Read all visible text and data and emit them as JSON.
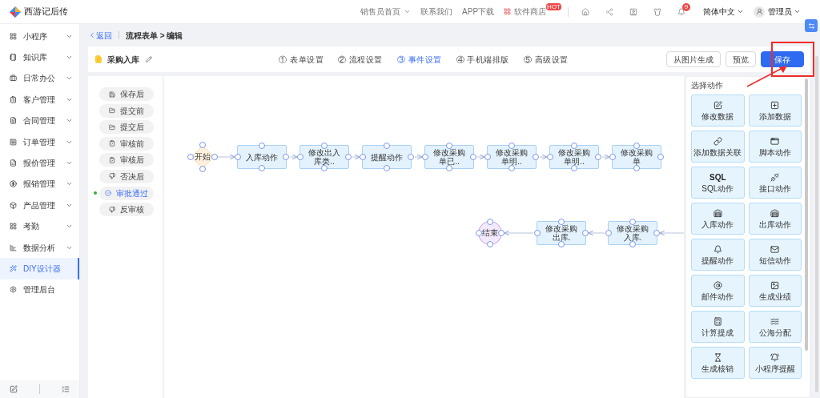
{
  "header": {
    "brand": "西游记后传",
    "links": [
      {
        "label": "销售员首页",
        "caret": true
      },
      {
        "label": "联系我们",
        "caret": false
      },
      {
        "label": "APP下载",
        "caret": false
      }
    ],
    "store": {
      "label": "软件商店",
      "badge": "HOT"
    },
    "notification_badge": "9",
    "language": "简体中文",
    "user": "管理员"
  },
  "sidebar": {
    "items": [
      {
        "label": "小程序",
        "expandable": true,
        "selected": false
      },
      {
        "label": "知识库",
        "expandable": true,
        "selected": false
      },
      {
        "label": "日常办公",
        "expandable": true,
        "selected": false
      },
      {
        "label": "客户管理",
        "expandable": true,
        "selected": false
      },
      {
        "label": "合同管理",
        "expandable": true,
        "selected": false
      },
      {
        "label": "订单管理",
        "expandable": true,
        "selected": false
      },
      {
        "label": "报价管理",
        "expandable": true,
        "selected": false
      },
      {
        "label": "报销管理",
        "expandable": true,
        "selected": false
      },
      {
        "label": "产品管理",
        "expandable": true,
        "selected": false
      },
      {
        "label": "考勤",
        "expandable": true,
        "selected": false
      },
      {
        "label": "数据分析",
        "expandable": true,
        "selected": false
      },
      {
        "label": "DIY设计器",
        "expandable": false,
        "selected": true
      },
      {
        "label": "管理后台",
        "expandable": false,
        "selected": false
      }
    ]
  },
  "breadcrumb": {
    "back": "返回",
    "path": "流程表单 > 编辑"
  },
  "toolbar": {
    "form_name": "采购入库",
    "tabs": [
      {
        "label": "① 表单设置",
        "selected": false
      },
      {
        "label": "② 流程设置",
        "selected": false
      },
      {
        "label": "③ 事件设置",
        "selected": true
      },
      {
        "label": "④ 手机端排版",
        "selected": false
      },
      {
        "label": "⑤ 高级设置",
        "selected": false
      }
    ],
    "buttons": [
      {
        "label": "从图片生成",
        "kind": "default"
      },
      {
        "label": "预览",
        "kind": "default"
      },
      {
        "label": "保存",
        "kind": "primary"
      }
    ]
  },
  "events": [
    {
      "label": "保存后",
      "selected": false
    },
    {
      "label": "提交前",
      "selected": false
    },
    {
      "label": "提交后",
      "selected": false
    },
    {
      "label": "审核前",
      "selected": false
    },
    {
      "label": "审核后",
      "selected": false
    },
    {
      "label": "否决后",
      "selected": false
    },
    {
      "label": "审批通过",
      "selected": true
    },
    {
      "label": "反审核",
      "selected": false
    }
  ],
  "flow": {
    "row_1": [
      {
        "kind": "start",
        "label": "开始"
      },
      {
        "kind": "action",
        "label": "入库动作"
      },
      {
        "kind": "action",
        "label": "修改出入库类.."
      },
      {
        "kind": "action",
        "label": "提醒动作"
      },
      {
        "kind": "action",
        "label": "修改采购单已.."
      },
      {
        "kind": "action",
        "label": "修改采购单明.."
      },
      {
        "kind": "action",
        "label": "修改采购单明.."
      },
      {
        "kind": "action",
        "label": "修改采购单"
      }
    ],
    "row_2": [
      {
        "kind": "end",
        "label": "结束"
      },
      {
        "kind": "action",
        "label": "修改采购出库."
      },
      {
        "kind": "action",
        "label": "修改采购入库."
      }
    ]
  },
  "actions": {
    "title": "选择动作",
    "items": [
      {
        "label": "修改数据"
      },
      {
        "label": "添加数据"
      },
      {
        "label": "添加数据关联"
      },
      {
        "label": "脚本动作"
      },
      {
        "label": "SQL动作",
        "glyph": "SQL"
      },
      {
        "label": "接口动作"
      },
      {
        "label": "入库动作"
      },
      {
        "label": "出库动作"
      },
      {
        "label": "提醒动作"
      },
      {
        "label": "短信动作"
      },
      {
        "label": "邮件动作"
      },
      {
        "label": "生成业绩"
      },
      {
        "label": "计算提成"
      },
      {
        "label": "公海分配"
      },
      {
        "label": "生成核销"
      },
      {
        "label": "小程序提醒"
      }
    ]
  }
}
